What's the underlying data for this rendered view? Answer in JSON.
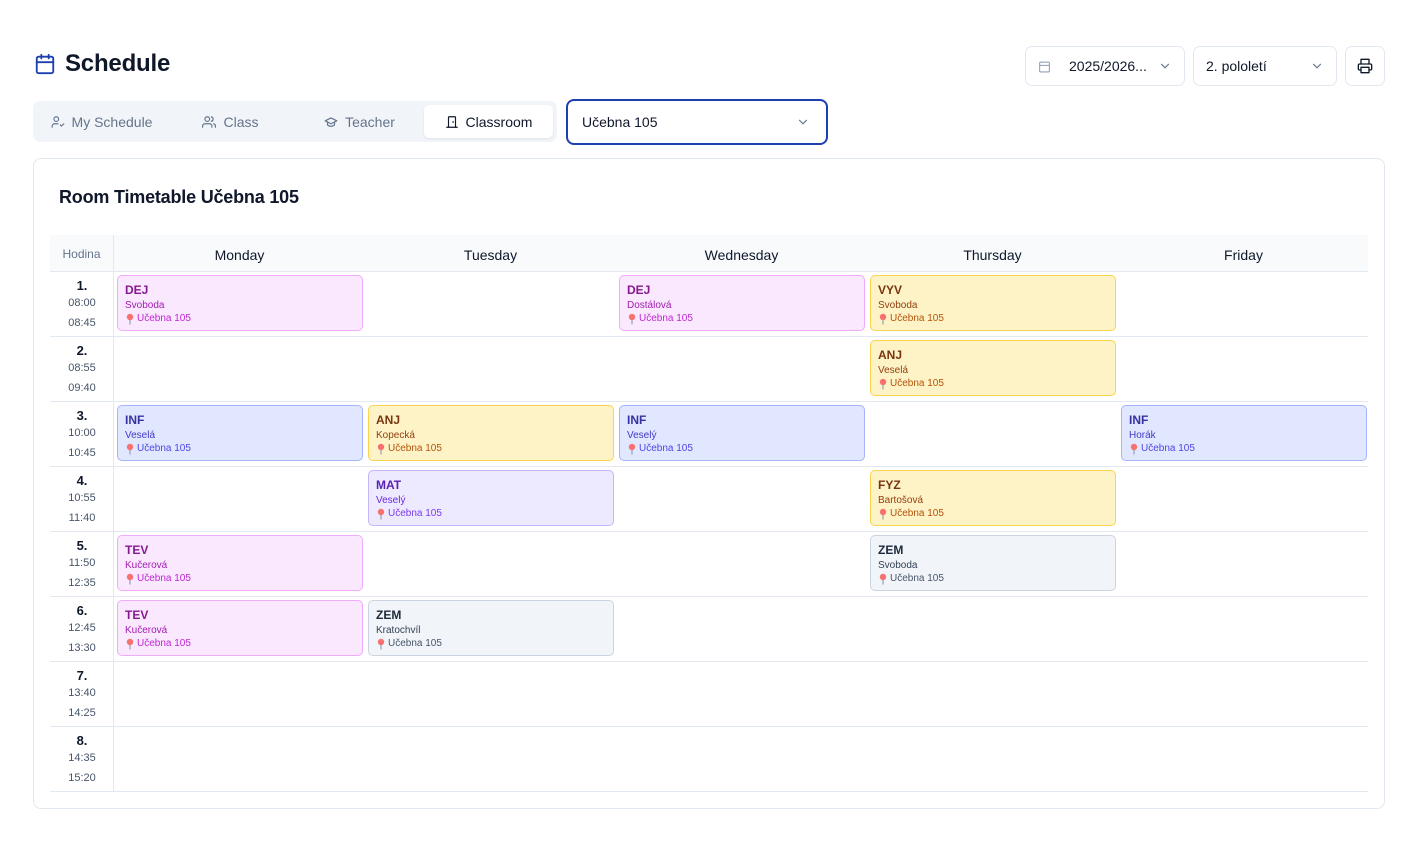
{
  "header": {
    "title": "Schedule"
  },
  "controls": {
    "school_year": "2025/2026...",
    "term": "2. pololetí"
  },
  "tabs": [
    {
      "label": "My Schedule",
      "icon": "user-check-icon",
      "active": false
    },
    {
      "label": "Class",
      "icon": "users-icon",
      "active": false
    },
    {
      "label": "Teacher",
      "icon": "graduation-cap-icon",
      "active": false
    },
    {
      "label": "Classroom",
      "icon": "door-icon",
      "active": true
    }
  ],
  "room_select": {
    "value": "Učebna 105"
  },
  "timetable": {
    "title": "Room Timetable Učebna 105",
    "period_header": "Hodina",
    "days": [
      "Monday",
      "Tuesday",
      "Wednesday",
      "Thursday",
      "Friday"
    ],
    "periods": [
      {
        "num": "1.",
        "start": "08:00",
        "end": "08:45"
      },
      {
        "num": "2.",
        "start": "08:55",
        "end": "09:40"
      },
      {
        "num": "3.",
        "start": "10:00",
        "end": "10:45"
      },
      {
        "num": "4.",
        "start": "10:55",
        "end": "11:40"
      },
      {
        "num": "5.",
        "start": "11:50",
        "end": "12:35"
      },
      {
        "num": "6.",
        "start": "12:45",
        "end": "13:30"
      },
      {
        "num": "7.",
        "start": "13:40",
        "end": "14:25"
      },
      {
        "num": "8.",
        "start": "14:35",
        "end": "15:20"
      }
    ],
    "lessons": [
      {
        "day": 0,
        "period": 0,
        "subject": "DEJ",
        "teacher": "Svoboda",
        "room": "Učebna 105",
        "color": "pink"
      },
      {
        "day": 2,
        "period": 0,
        "subject": "DEJ",
        "teacher": "Dostálová",
        "room": "Učebna 105",
        "color": "pink"
      },
      {
        "day": 3,
        "period": 0,
        "subject": "VYV",
        "teacher": "Svoboda",
        "room": "Učebna 105",
        "color": "yellow"
      },
      {
        "day": 3,
        "period": 1,
        "subject": "ANJ",
        "teacher": "Veselá",
        "room": "Učebna 105",
        "color": "yellow"
      },
      {
        "day": 0,
        "period": 2,
        "subject": "INF",
        "teacher": "Veselá",
        "room": "Učebna 105",
        "color": "blue"
      },
      {
        "day": 1,
        "period": 2,
        "subject": "ANJ",
        "teacher": "Kopecká",
        "room": "Učebna 105",
        "color": "yellow"
      },
      {
        "day": 2,
        "period": 2,
        "subject": "INF",
        "teacher": "Veselý",
        "room": "Učebna 105",
        "color": "blue"
      },
      {
        "day": 4,
        "period": 2,
        "subject": "INF",
        "teacher": "Horák",
        "room": "Učebna 105",
        "color": "blue"
      },
      {
        "day": 1,
        "period": 3,
        "subject": "MAT",
        "teacher": "Veselý",
        "room": "Učebna 105",
        "color": "purple"
      },
      {
        "day": 3,
        "period": 3,
        "subject": "FYZ",
        "teacher": "Bartošová",
        "room": "Učebna 105",
        "color": "yellow"
      },
      {
        "day": 0,
        "period": 4,
        "subject": "TEV",
        "teacher": "Kučerová",
        "room": "Učebna 105",
        "color": "pink"
      },
      {
        "day": 3,
        "period": 4,
        "subject": "ZEM",
        "teacher": "Svoboda",
        "room": "Učebna 105",
        "color": "gray"
      },
      {
        "day": 0,
        "period": 5,
        "subject": "TEV",
        "teacher": "Kučerová",
        "room": "Učebna 105",
        "color": "pink"
      },
      {
        "day": 1,
        "period": 5,
        "subject": "ZEM",
        "teacher": "Kratochvíl",
        "room": "Učebna 105",
        "color": "gray"
      }
    ]
  }
}
